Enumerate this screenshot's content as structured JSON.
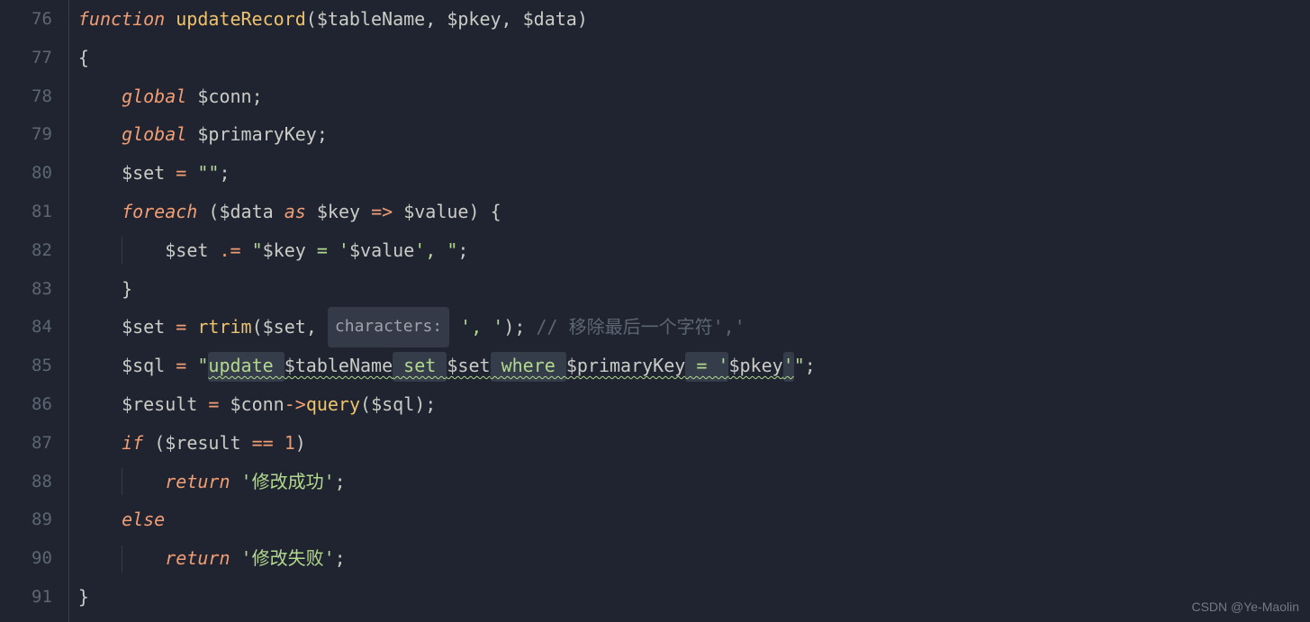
{
  "line_numbers": [
    "76",
    "77",
    "78",
    "79",
    "80",
    "81",
    "82",
    "83",
    "84",
    "85",
    "86",
    "87",
    "88",
    "89",
    "90",
    "91"
  ],
  "code": {
    "l76": {
      "function_kw": "function",
      "fn_name": "updateRecord",
      "p1": "$tableName",
      "p2": "$pkey",
      "p3": "$data"
    },
    "l77": {
      "brace": "{"
    },
    "l78": {
      "global_kw": "global",
      "var": "$conn"
    },
    "l79": {
      "global_kw": "global",
      "var": "$primaryKey"
    },
    "l80": {
      "var": "$set",
      "op": "=",
      "str": "\"\""
    },
    "l81": {
      "foreach_kw": "foreach",
      "data": "$data",
      "as_kw": "as",
      "key": "$key",
      "arrow": "=>",
      "value": "$value",
      "brace": "{"
    },
    "l82": {
      "var": "$set",
      "op": ".=",
      "q1": "\"",
      "v1": "$key",
      "s1": " = '",
      "v2": "$value",
      "s2": "', ",
      "q2": "\""
    },
    "l83": {
      "brace": "}"
    },
    "l84": {
      "var": "$set",
      "op": "=",
      "fn": "rtrim",
      "arg1": "$set",
      "hint": "characters:",
      "str": "', '",
      "comment": "// 移除最后一个字符','"
    },
    "l85": {
      "var": "$sql",
      "op": "=",
      "q1": "\"",
      "update": "update ",
      "v1": "$tableName",
      "set": " set ",
      "v2": "$set",
      "where": " where ",
      "v3": "$primaryKey",
      "eq": " = '",
      "v4": "$pkey",
      "end": "'",
      "q2": "\""
    },
    "l86": {
      "var": "$result",
      "op": "=",
      "conn": "$conn",
      "arrow": "->",
      "method": "query",
      "arg": "$sql"
    },
    "l87": {
      "if_kw": "if",
      "var": "$result",
      "op": "==",
      "num": "1"
    },
    "l88": {
      "return_kw": "return",
      "str": "'修改成功'"
    },
    "l89": {
      "else_kw": "else"
    },
    "l90": {
      "return_kw": "return",
      "str": "'修改失败'"
    },
    "l91": {
      "brace": "}"
    }
  },
  "watermark": "CSDN @Ye-Maolin"
}
